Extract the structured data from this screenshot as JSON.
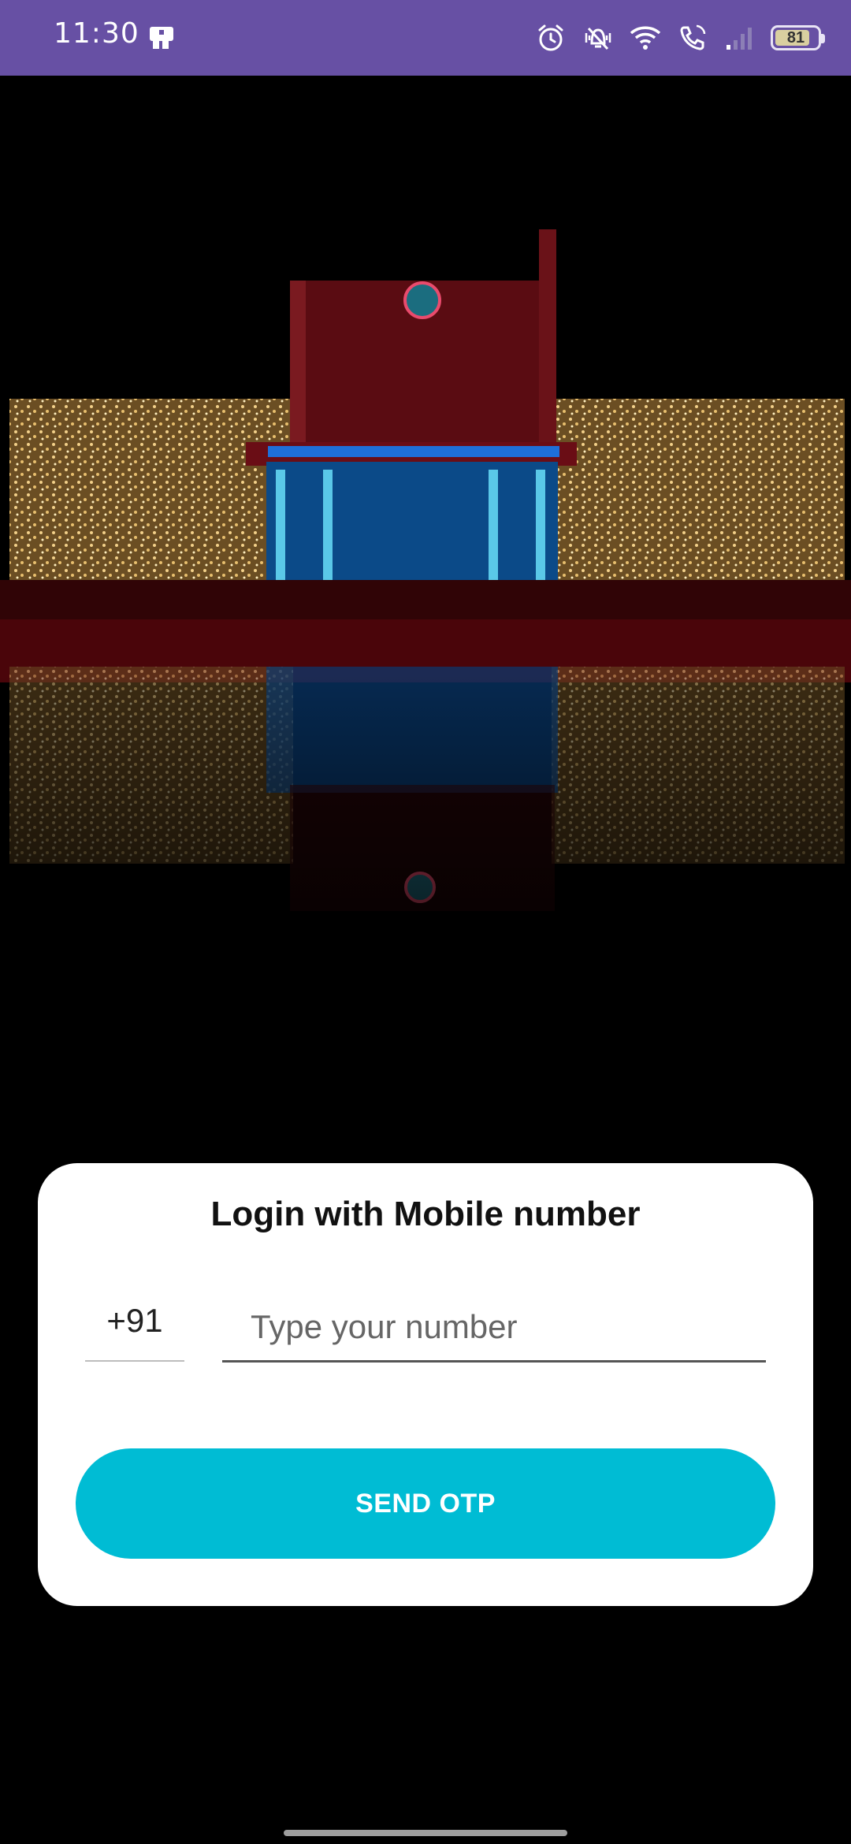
{
  "status_bar": {
    "time": "11:30",
    "battery_level": "81",
    "icons": [
      "app-notification-icon",
      "alarm-icon",
      "vibrate-icon",
      "wifi-icon",
      "wifi-calling-icon",
      "signal-icon",
      "battery-icon"
    ],
    "background_color": "#6750a4"
  },
  "hero": {
    "image": "illuminated-building-night-photo"
  },
  "login": {
    "title": "Login with Mobile number",
    "country_code": "+91",
    "phone_placeholder": "Type your number",
    "phone_value": "",
    "send_button_label": "SEND OTP",
    "accent_color": "#00bcd4"
  }
}
